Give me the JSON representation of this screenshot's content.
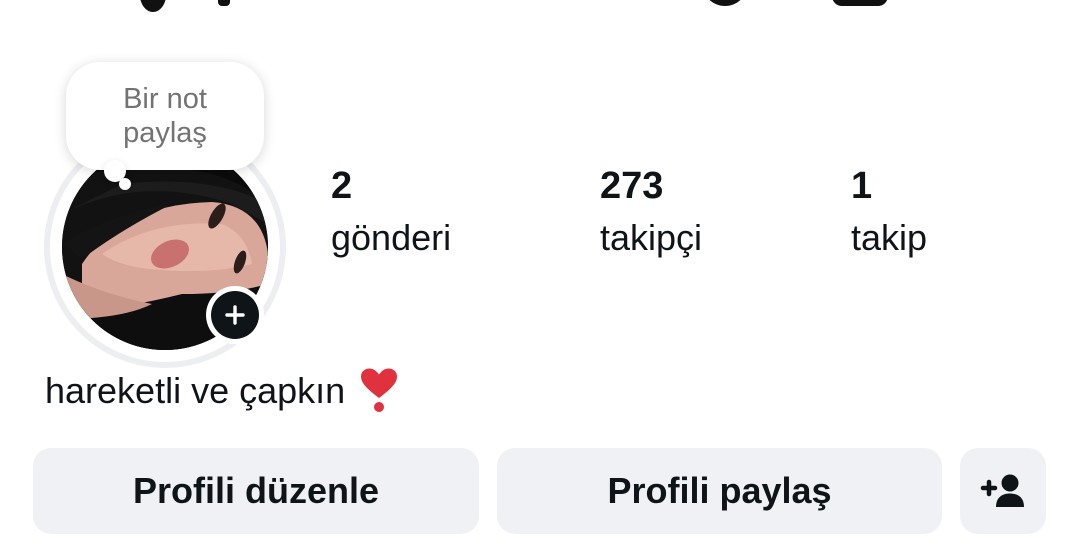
{
  "note": {
    "placeholder_line1": "Bir not",
    "placeholder_line2": "paylaş"
  },
  "avatar": {
    "add_story_icon": "plus-icon"
  },
  "stats": {
    "posts": {
      "count": "2",
      "label": "gönderi"
    },
    "followers": {
      "count": "273",
      "label": "takipçi"
    },
    "following": {
      "count": "1",
      "label": "takip"
    }
  },
  "bio": {
    "text": "hareketli ve çapkın",
    "emoji": "heavy-heart-exclamation-icon"
  },
  "actions": {
    "edit_profile": "Profili düzenle",
    "share_profile": "Profili paylaş",
    "add_user_icon": "add-user-icon"
  },
  "colors": {
    "button_bg": "#eff1f5",
    "text": "#0f1419",
    "muted": "#737373",
    "heart": "#e0313f"
  }
}
